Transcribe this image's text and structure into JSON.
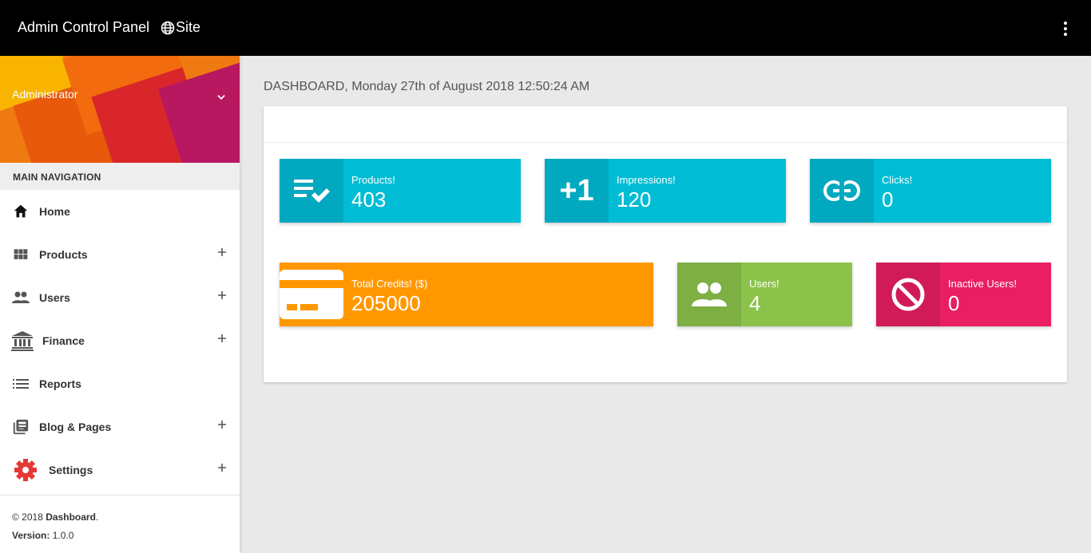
{
  "topbar": {
    "brand": "Admin Control Panel",
    "site_link": "Site"
  },
  "sidebar": {
    "user_name": "Administrator",
    "nav_header": "MAIN NAVIGATION",
    "items": [
      {
        "label": "Home",
        "icon": "home-icon",
        "expandable": false
      },
      {
        "label": "Products",
        "icon": "grid-icon",
        "expandable": true
      },
      {
        "label": "Users",
        "icon": "people-icon",
        "expandable": true
      },
      {
        "label": "Finance",
        "icon": "bank-icon",
        "expandable": true
      },
      {
        "label": "Reports",
        "icon": "list-icon",
        "expandable": false
      },
      {
        "label": "Blog & Pages",
        "icon": "library-books-icon",
        "expandable": true
      },
      {
        "label": "Settings",
        "icon": "gear-icon",
        "expandable": true
      }
    ],
    "footer": {
      "copyright_prefix": "© 2018 ",
      "copyright_name": "Dashboard",
      "copyright_suffix": ".",
      "version_label": "Version:",
      "version_value": " 1.0.0"
    }
  },
  "main": {
    "heading": "DASHBOARD, Monday 27th of August 2018 12:50:24 AM",
    "stats": [
      {
        "label": "Products!",
        "value": "403",
        "icon": "playlist-check-icon",
        "color": "#00bcd4",
        "icon_bg": "#00a9bf"
      },
      {
        "label": "Impressions!",
        "value": "120",
        "icon": "plus-one-icon",
        "color": "#00bcd4",
        "icon_bg": "#00a9bf"
      },
      {
        "label": "Clicks!",
        "value": "0",
        "icon": "link-icon",
        "color": "#00bcd4",
        "icon_bg": "#00a9bf"
      },
      {
        "label": "Total Credits! ($)",
        "value": "205000",
        "icon": "credit-card-icon",
        "color": "#ff9800",
        "icon_bg": "#ff9800"
      },
      {
        "label": "Users!",
        "value": "4",
        "icon": "group-icon",
        "color": "#8bc34a",
        "icon_bg": "#7daf43"
      },
      {
        "label": "Inactive Users!",
        "value": "0",
        "icon": "block-icon",
        "color": "#e91e63",
        "icon_bg": "#d11b59"
      }
    ]
  },
  "colors": {
    "topbar": "#000000",
    "cyan": "#00bcd4",
    "orange": "#ff9800",
    "green": "#8bc34a",
    "pink": "#e91e63",
    "settings_icon": "#e53935"
  }
}
